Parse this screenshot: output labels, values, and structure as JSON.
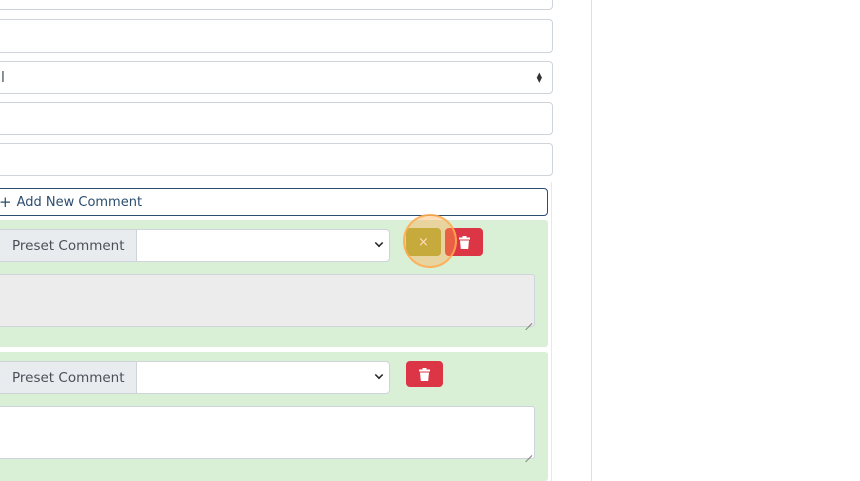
{
  "form": {
    "select_value": "l"
  },
  "comments": {
    "add_label": "Add New Comment",
    "items": [
      {
        "preset_label": "Preset Comment",
        "preset_value": ""
      },
      {
        "preset_label": "Preset Comment",
        "preset_value": ""
      }
    ],
    "cancel_icon": "×"
  },
  "icons": {
    "plus": "+",
    "sort_up": "▲",
    "sort_down": "▼"
  },
  "colors": {
    "comment_bg": "#d9efd6",
    "cancel_button": "#a3ab36",
    "delete_button": "#dc3545",
    "add_border": "#2b4d6e"
  }
}
